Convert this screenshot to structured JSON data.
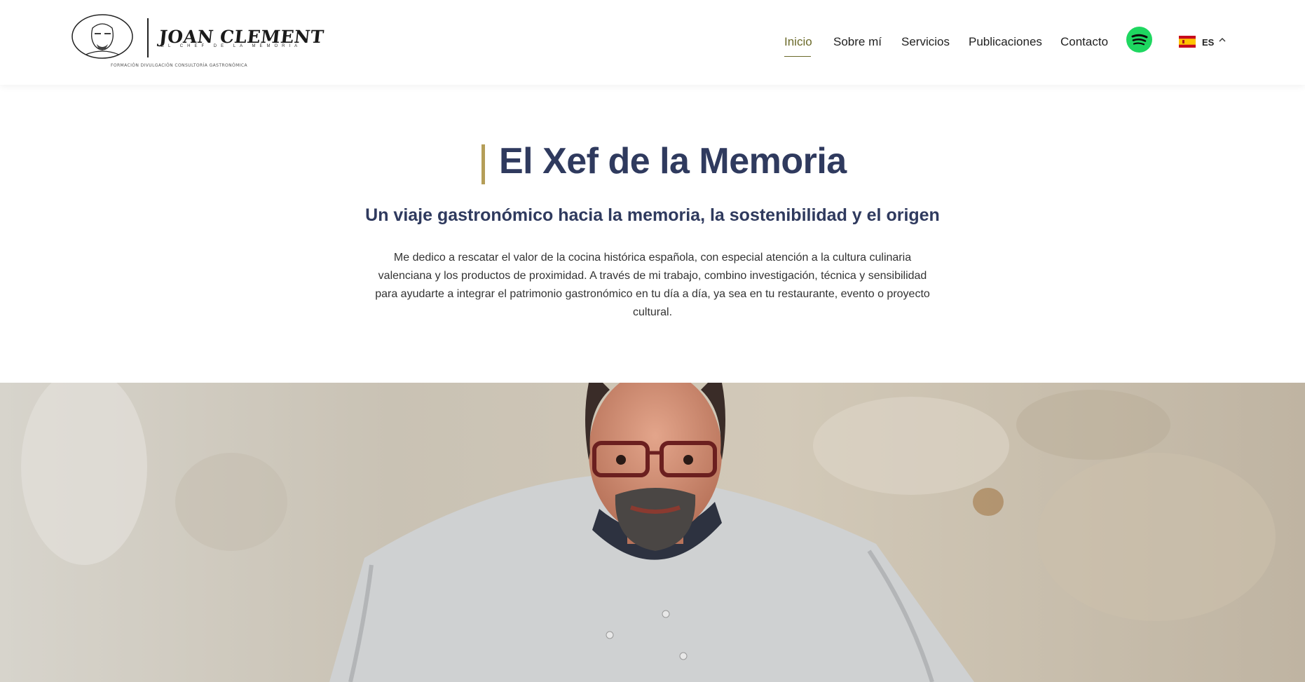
{
  "brand": {
    "name": "JOAN CLEMENT",
    "subtitle": "EL CHEF DE LA MEMORIA",
    "tagline": "FORMACIÓN DIVULGACIÓN CONSULTORÍA GASTRONÓMICA"
  },
  "nav": {
    "items": [
      {
        "label": "Inicio",
        "active": true
      },
      {
        "label": "Sobre mí",
        "active": false
      },
      {
        "label": "Servicios",
        "active": false
      },
      {
        "label": "Publicaciones",
        "active": false
      },
      {
        "label": "Contacto",
        "active": false
      }
    ],
    "spotify_icon": "spotify-icon",
    "language": {
      "code": "ES",
      "flag": "spain-flag-icon"
    }
  },
  "hero": {
    "title": "El Xef de la Memoria",
    "subtitle": "Un viaje gastronómico hacia la memoria, la sostenibilidad y el origen",
    "intro": "Me dedico a rescatar el valor de la cocina histórica española, con especial atención a la cultura culinaria valenciana y los productos de proximidad. A través de mi trabajo, combino investigación, técnica y sensibilidad para ayudarte a integrar el patrimonio gastronómico en tu día a día, ya sea en tu restaurante, evento o proyecto cultural."
  },
  "colors": {
    "accent": "#6b6a2a",
    "title": "#2f3a5e",
    "bar": "#b59e58",
    "spotify": "#1ed760"
  }
}
